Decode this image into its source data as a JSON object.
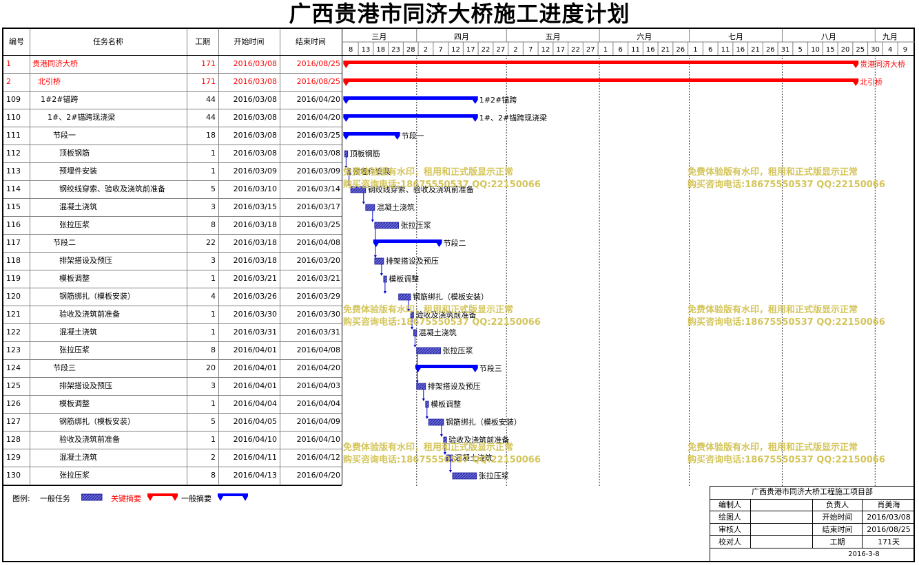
{
  "title": "广西贵港市同济大桥施工进度计划",
  "table": {
    "headers": {
      "id": "编号",
      "name": "任务名称",
      "duration": "工期",
      "start": "开始时间",
      "end": "结束时间"
    }
  },
  "timeline": {
    "months": [
      "三月",
      "四月",
      "五月",
      "六月",
      "七月",
      "八月",
      "九月"
    ],
    "days": [
      "8",
      "13",
      "18",
      "23",
      "28",
      "2",
      "7",
      "12",
      "17",
      "22",
      "27",
      "2",
      "7",
      "12",
      "17",
      "22",
      "27",
      "1",
      "6",
      "11",
      "16",
      "21",
      "26",
      "1",
      "6",
      "11",
      "16",
      "21",
      "26",
      "31",
      "5",
      "10",
      "15",
      "20",
      "25",
      "30",
      "4",
      "9"
    ]
  },
  "colors": {
    "critical": "#ff0000",
    "summary": "#0000ff",
    "task": "#3333cc",
    "watermark": "#d4c55a"
  },
  "chart_data": {
    "type": "gantt",
    "x_range": [
      "2016-03-07",
      "2016-09-11"
    ],
    "tasks": [
      {
        "id": "1",
        "name": "贵港同济大桥",
        "duration": "171",
        "start": "2016/03/08",
        "end": "2016/08/25",
        "kind": "critical",
        "level": 0,
        "label": "贵港同济大桥"
      },
      {
        "id": "2",
        "name": "北引桥",
        "duration": "171",
        "start": "2016/03/08",
        "end": "2016/08/25",
        "kind": "critical",
        "level": 1,
        "label": "北引桥"
      },
      {
        "id": "109",
        "name": "1#2#锚跨",
        "duration": "44",
        "start": "2016/03/08",
        "end": "2016/04/20",
        "kind": "summary",
        "level": 2,
        "label": "1#2#锚跨"
      },
      {
        "id": "110",
        "name": "1#、2#锚跨现浇梁",
        "duration": "44",
        "start": "2016/03/08",
        "end": "2016/04/20",
        "kind": "summary",
        "level": 3,
        "label": "1#、2#锚跨现浇梁"
      },
      {
        "id": "111",
        "name": "节段一",
        "duration": "18",
        "start": "2016/03/08",
        "end": "2016/03/25",
        "kind": "summary",
        "level": 4,
        "label": "节段一"
      },
      {
        "id": "112",
        "name": "顶板钢筋",
        "duration": "1",
        "start": "2016/03/08",
        "end": "2016/03/08",
        "kind": "task",
        "level": 5,
        "label": "顶板钢筋"
      },
      {
        "id": "113",
        "name": "预埋件安装",
        "duration": "1",
        "start": "2016/03/09",
        "end": "2016/03/09",
        "kind": "task",
        "level": 5,
        "label": "预埋件安装"
      },
      {
        "id": "114",
        "name": "钢绞线穿索、验收及浇筑前准备",
        "duration": "5",
        "start": "2016/03/10",
        "end": "2016/03/14",
        "kind": "task",
        "level": 5,
        "label": "钢绞线穿索、验收及浇筑前准备"
      },
      {
        "id": "115",
        "name": "混凝土浇筑",
        "duration": "3",
        "start": "2016/03/15",
        "end": "2016/03/17",
        "kind": "task",
        "level": 5,
        "label": "混凝土浇筑"
      },
      {
        "id": "116",
        "name": "张拉压浆",
        "duration": "8",
        "start": "2016/03/18",
        "end": "2016/03/25",
        "kind": "task",
        "level": 5,
        "label": "张拉压浆"
      },
      {
        "id": "117",
        "name": "节段二",
        "duration": "22",
        "start": "2016/03/18",
        "end": "2016/04/08",
        "kind": "summary",
        "level": 4,
        "label": "节段二"
      },
      {
        "id": "118",
        "name": "排架搭设及预压",
        "duration": "3",
        "start": "2016/03/18",
        "end": "2016/03/20",
        "kind": "task",
        "level": 5,
        "label": "排架搭设及预压"
      },
      {
        "id": "119",
        "name": "模板调整",
        "duration": "1",
        "start": "2016/03/21",
        "end": "2016/03/21",
        "kind": "task",
        "level": 5,
        "label": "模板调整"
      },
      {
        "id": "120",
        "name": "钢筋绑扎（模板安装）",
        "duration": "4",
        "start": "2016/03/26",
        "end": "2016/03/29",
        "kind": "task",
        "level": 5,
        "label": "钢筋绑扎（模板安装）"
      },
      {
        "id": "121",
        "name": "验收及浇筑前准备",
        "duration": "1",
        "start": "2016/03/30",
        "end": "2016/03/30",
        "kind": "task",
        "level": 5,
        "label": "验收及浇筑前准备"
      },
      {
        "id": "122",
        "name": "混凝土浇筑",
        "duration": "1",
        "start": "2016/03/31",
        "end": "2016/03/31",
        "kind": "task",
        "level": 5,
        "label": "混凝土浇筑"
      },
      {
        "id": "123",
        "name": "张拉压浆",
        "duration": "8",
        "start": "2016/04/01",
        "end": "2016/04/08",
        "kind": "task",
        "level": 5,
        "label": "张拉压浆"
      },
      {
        "id": "124",
        "name": "节段三",
        "duration": "20",
        "start": "2016/04/01",
        "end": "2016/04/20",
        "kind": "summary",
        "level": 4,
        "label": "节段三"
      },
      {
        "id": "125",
        "name": "排架搭设及预压",
        "duration": "3",
        "start": "2016/04/01",
        "end": "2016/04/03",
        "kind": "task",
        "level": 5,
        "label": "排架搭设及预压"
      },
      {
        "id": "126",
        "name": "模板调整",
        "duration": "1",
        "start": "2016/04/04",
        "end": "2016/04/04",
        "kind": "task",
        "level": 5,
        "label": "模板调整"
      },
      {
        "id": "127",
        "name": "钢筋绑扎（模板安装）",
        "duration": "5",
        "start": "2016/04/05",
        "end": "2016/04/09",
        "kind": "task",
        "level": 5,
        "label": "钢筋绑扎（模板安装）"
      },
      {
        "id": "128",
        "name": "验收及浇筑前准备",
        "duration": "1",
        "start": "2016/04/10",
        "end": "2016/04/10",
        "kind": "task",
        "level": 5,
        "label": "验收及浇筑前准备"
      },
      {
        "id": "129",
        "name": "混凝土浇筑",
        "duration": "2",
        "start": "2016/04/11",
        "end": "2016/04/12",
        "kind": "task",
        "level": 5,
        "label": "混凝土浇筑"
      },
      {
        "id": "130",
        "name": "张拉压浆",
        "duration": "8",
        "start": "2016/04/13",
        "end": "2016/04/20",
        "kind": "task",
        "level": 5,
        "label": "张拉压浆"
      }
    ]
  },
  "legend": {
    "label": "图例:",
    "task": "一般任务",
    "critical": "关键摘要",
    "summary": "一般摘要"
  },
  "watermark": {
    "line1": "免费体验版有水印，租用和正式版显示正常",
    "line2": "购买咨询电话:18675550537 QQ:22150066"
  },
  "info": {
    "project": "广西贵港市同济大桥工程施工项目部",
    "rows": [
      {
        "k1": "编制人",
        "v1": "",
        "k2": "负责人",
        "v2": "肖美海"
      },
      {
        "k1": "绘图人",
        "v1": "",
        "k2": "开始时间",
        "v2": "2016/03/08"
      },
      {
        "k1": "审核人",
        "v1": "",
        "k2": "结束时间",
        "v2": "2016/08/25"
      },
      {
        "k1": "校对人",
        "v1": "",
        "k2": "工期",
        "v2": "171天"
      }
    ],
    "date": "2016-3-8"
  }
}
